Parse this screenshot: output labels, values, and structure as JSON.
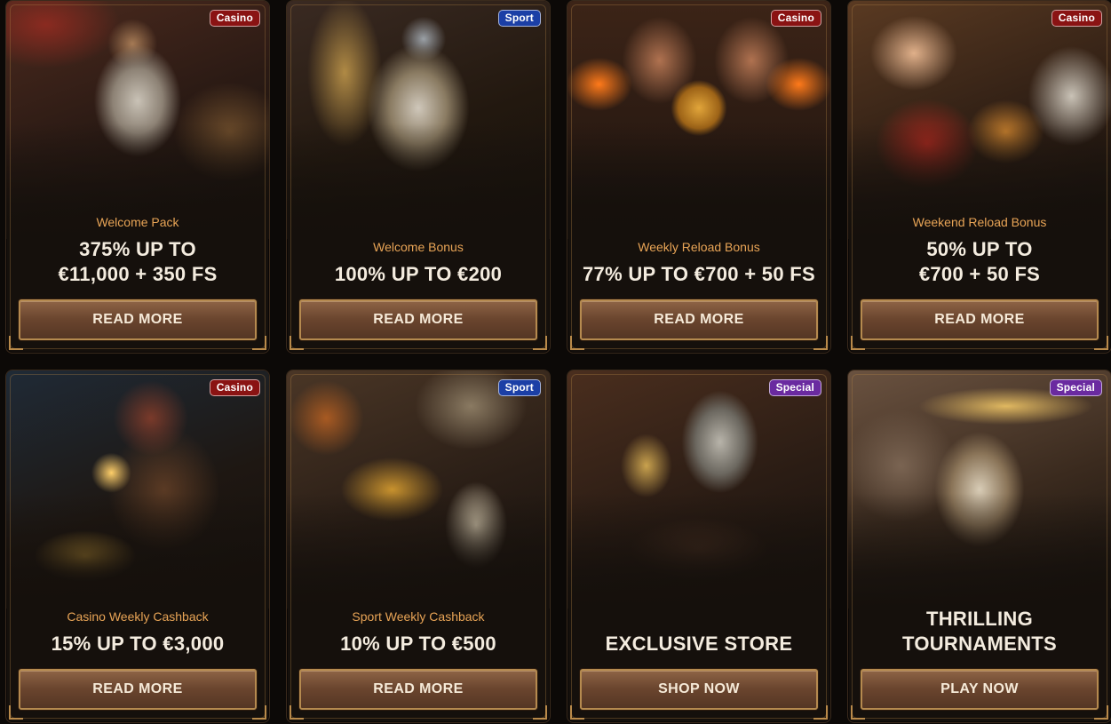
{
  "promotions": [
    {
      "badge": "Casino",
      "badge_type": "casino",
      "subtitle": "Welcome Pack",
      "headline": "375% UP TO\n€11,000 + 350 FS",
      "cta": "READ MORE",
      "illustration": "knight-lion-tabard"
    },
    {
      "badge": "Sport",
      "badge_type": "sport",
      "subtitle": "Welcome Bonus",
      "headline": "100% UP TO €200",
      "cta": "READ MORE",
      "illustration": "armored-knight-lance"
    },
    {
      "badge": "Casino",
      "badge_type": "casino",
      "subtitle": "Weekly Reload Bonus",
      "headline": "77% UP TO €700 + 50 FS",
      "cta": "READ MORE",
      "illustration": "blacksmiths-golden-orb"
    },
    {
      "badge": "Casino",
      "badge_type": "casino",
      "subtitle": "Weekend Reload Bonus",
      "headline": "50% UP TO\n€700 + 50 FS",
      "cta": "READ MORE",
      "illustration": "tavern-maid-pouring"
    },
    {
      "badge": "Casino",
      "badge_type": "casino",
      "subtitle": "Casino Weekly Cashback",
      "headline": "15% UP TO €3,000",
      "cta": "READ MORE",
      "illustration": "merchant-counting-gold"
    },
    {
      "badge": "Sport",
      "badge_type": "sport",
      "subtitle": "Sport Weekly Cashback",
      "headline": "10% UP TO €500",
      "cta": "READ MORE",
      "illustration": "treasure-cart-knights"
    },
    {
      "badge": "Special",
      "badge_type": "special",
      "subtitle": "",
      "headline": "EXCLUSIVE STORE",
      "cta": "SHOP NOW",
      "illustration": "armor-and-weapons"
    },
    {
      "badge": "Special",
      "badge_type": "special",
      "subtitle": "",
      "headline": "THRILLING\nTOURNAMENTS",
      "cta": "PLAY NOW",
      "illustration": "cheering-crowd-knight"
    }
  ],
  "colors": {
    "background": "#0c0907",
    "card": "#15100c",
    "subtitle": "#e8a456",
    "headline": "#f4ecdf",
    "button_border": "#b58a4f",
    "badge_casino": "#8a1313",
    "badge_sport": "#1b3fa6",
    "badge_special": "#6a2aa0"
  }
}
